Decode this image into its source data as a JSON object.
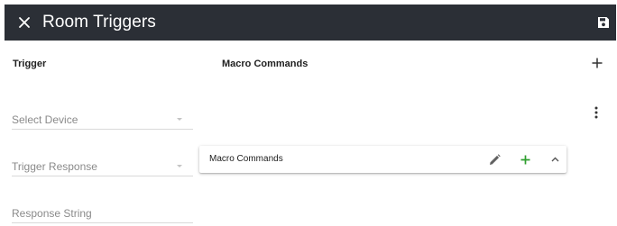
{
  "header": {
    "title": "Room Triggers",
    "close_icon": "close-icon",
    "save_icon": "save-icon",
    "background": "#2b2f36"
  },
  "columns": {
    "trigger": "Trigger",
    "macro_commands": "Macro Commands"
  },
  "fields": {
    "device": {
      "label": "Select Device",
      "type": "select"
    },
    "trigger_response": {
      "label": "Trigger Response",
      "type": "select"
    },
    "response_string": {
      "label": "Response String",
      "type": "text"
    }
  },
  "macro_panel": {
    "title": "Macro Commands",
    "edit_icon": "pencil-icon",
    "add_icon": "plus-icon",
    "collapse_icon": "chevron-up-icon",
    "add_color": "#2e9e2e"
  },
  "actions": {
    "add_icon": "plus-icon",
    "more_icon": "more-vertical-icon"
  }
}
